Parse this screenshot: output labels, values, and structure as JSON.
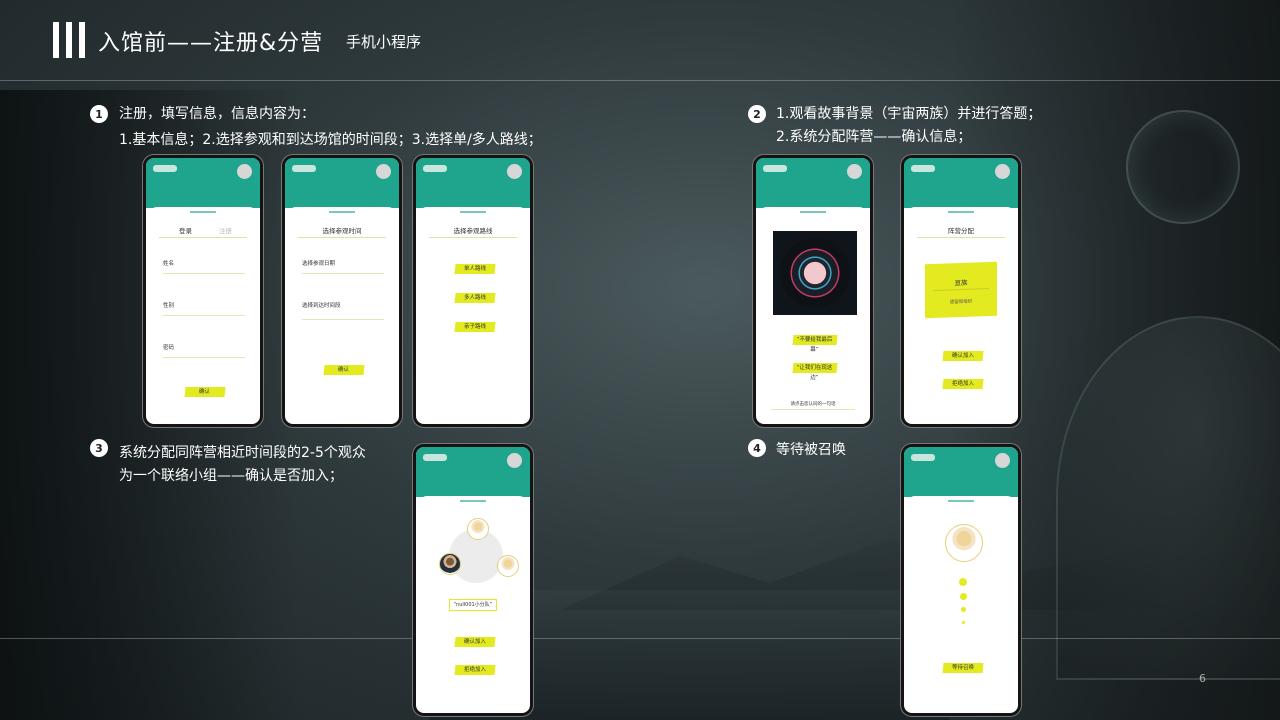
{
  "header": {
    "title": "入馆前——注册&分营",
    "subtitle": "手机小程序"
  },
  "page_number": "6",
  "steps": [
    {
      "num": "1",
      "lines": [
        "注册，填写信息，信息内容为：",
        "1.基本信息；2.选择参观和到达场馆的时间段；3.选择单/多人路线；"
      ]
    },
    {
      "num": "2",
      "lines": [
        "1.观看故事背景（宇宙两族）并进行答题；",
        "2.系统分配阵营——确认信息；"
      ]
    },
    {
      "num": "3",
      "lines": [
        "系统分配同阵营相近时间段的2-5个观众",
        "为一个联络小组——确认是否加入；"
      ]
    },
    {
      "num": "4",
      "lines": [
        "等待被召唤"
      ]
    }
  ],
  "phones": {
    "login": {
      "tab_login": "登录",
      "tab_register": "注册",
      "field_name": "姓名",
      "field_gender": "性别",
      "field_password": "密码",
      "button": "确认"
    },
    "time": {
      "title": "选择参观时间",
      "field_date": "选择参观日期",
      "field_arrival": "选择到达时间段",
      "button": "确认"
    },
    "route": {
      "title": "选择参观路线",
      "opt_single": "单人路线",
      "opt_multi": "多人路线",
      "opt_family": "亲子路线"
    },
    "story": {
      "answer_a": "“不要给我最后幕”",
      "answer_b": "“让我们在现这边”",
      "footer": "请点击您认同的一句话"
    },
    "camp": {
      "title": "阵营分配",
      "camp_name": "亘族",
      "camp_desc": "遗留和组织",
      "confirm": "确认加入",
      "reject": "拒绝加入"
    },
    "group": {
      "tag": "“null001小分队”",
      "confirm": "确认加入",
      "reject": "拒绝加入"
    },
    "wait": {
      "button": "等待召唤"
    }
  },
  "colors": {
    "phone_header": "#1fa58d",
    "accent_yellow": "#e3eb20"
  }
}
